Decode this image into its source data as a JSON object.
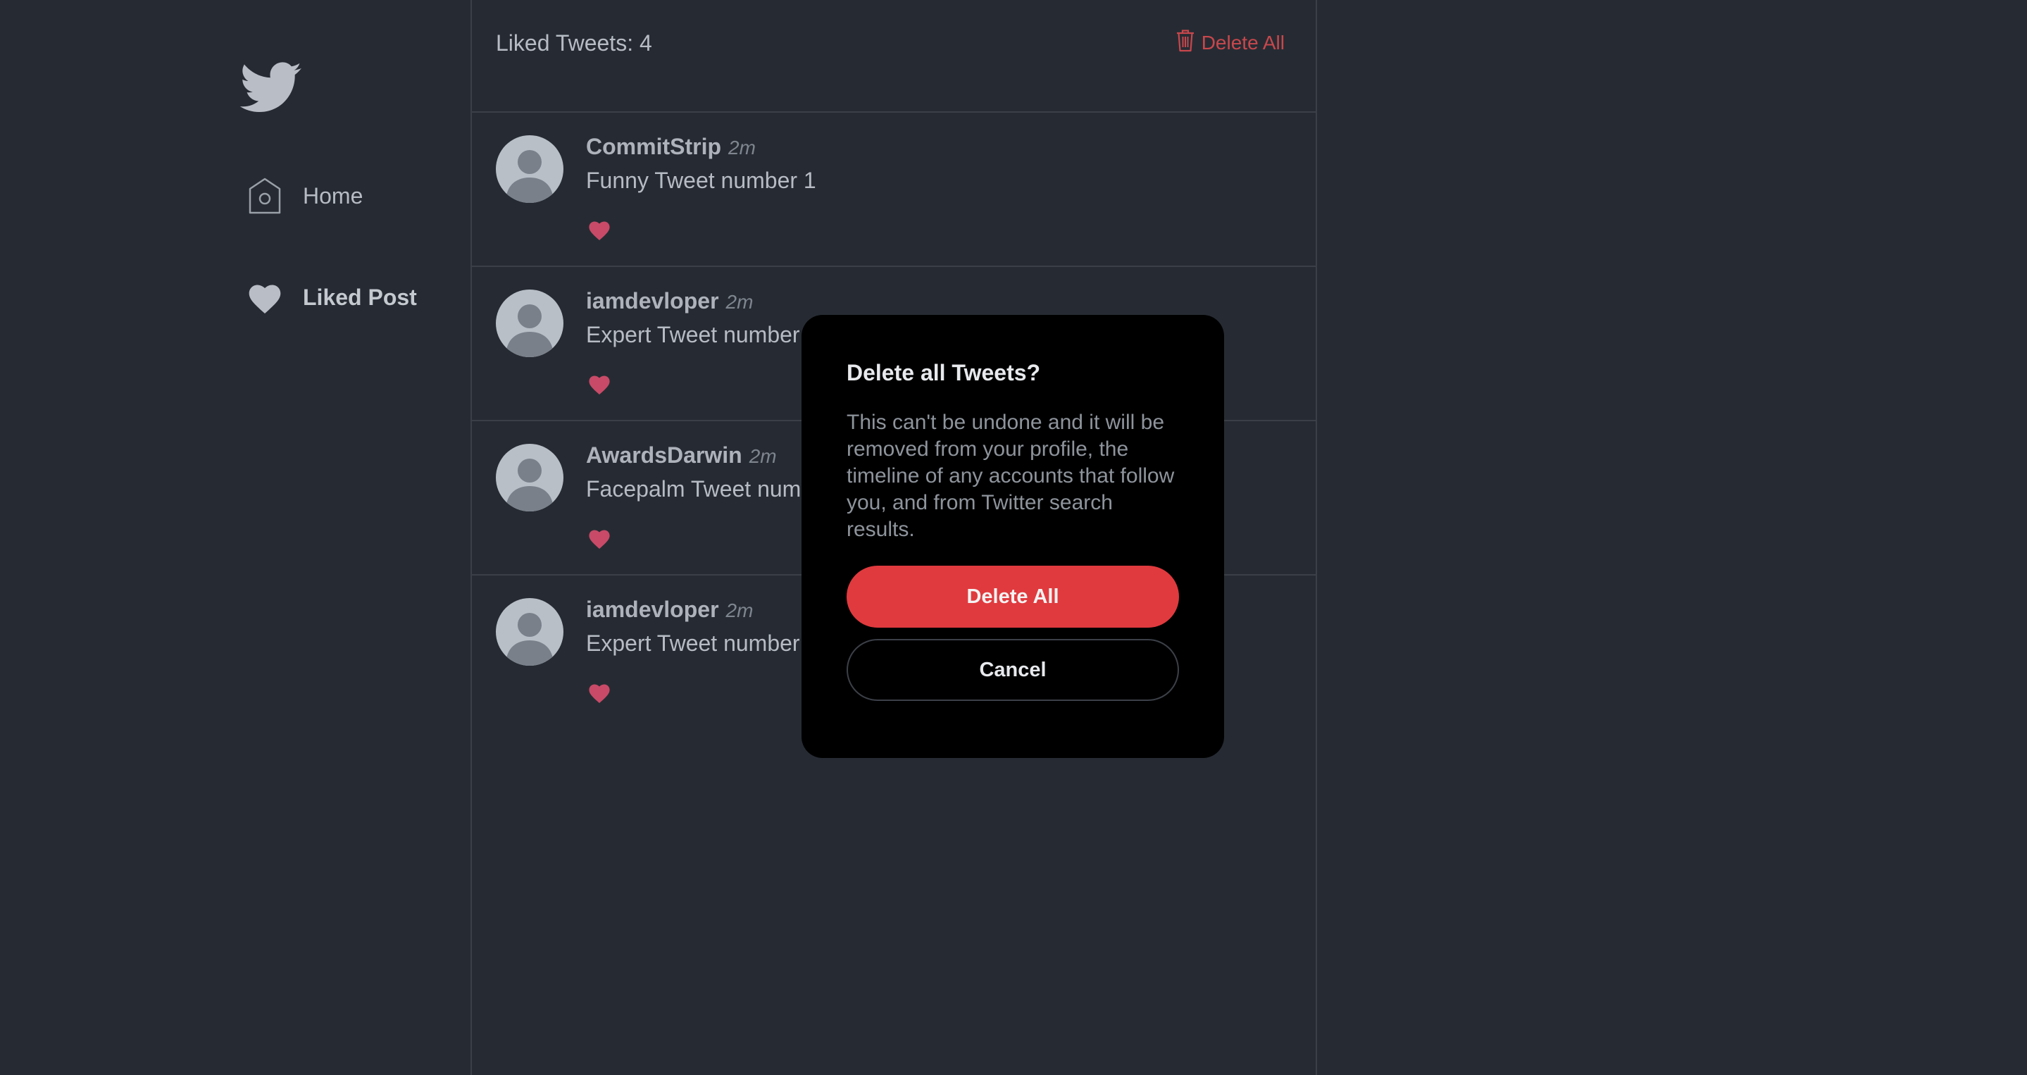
{
  "sidebar": {
    "logo_icon": "twitter-bird-icon",
    "items": [
      {
        "label": "Home",
        "icon": "home-icon"
      },
      {
        "label": "Liked Post",
        "icon": "heart-icon"
      }
    ]
  },
  "header": {
    "count_label": "Liked Tweets: 4",
    "delete_all_label": "Delete All",
    "delete_icon": "trash-icon"
  },
  "tweets": [
    {
      "author": "CommitStrip",
      "time": "2m",
      "text": "Funny Tweet number 1",
      "liked": true
    },
    {
      "author": "iamdevloper",
      "time": "2m",
      "text": "Expert Tweet number",
      "liked": true
    },
    {
      "author": "AwardsDarwin",
      "time": "2m",
      "text": "Facepalm Tweet num",
      "liked": true
    },
    {
      "author": "iamdevloper",
      "time": "2m",
      "text": "Expert Tweet number",
      "liked": true
    }
  ],
  "modal": {
    "title": "Delete all Tweets?",
    "text": "This can't be undone and it will be removed from your profile, the timeline of any accounts that follow you, and from Twitter search results.",
    "confirm_label": "Delete All",
    "cancel_label": "Cancel"
  },
  "colors": {
    "background": "#262b33",
    "danger": "#e03a3e",
    "heart": "#c84a68",
    "modal_bg": "#000000"
  }
}
